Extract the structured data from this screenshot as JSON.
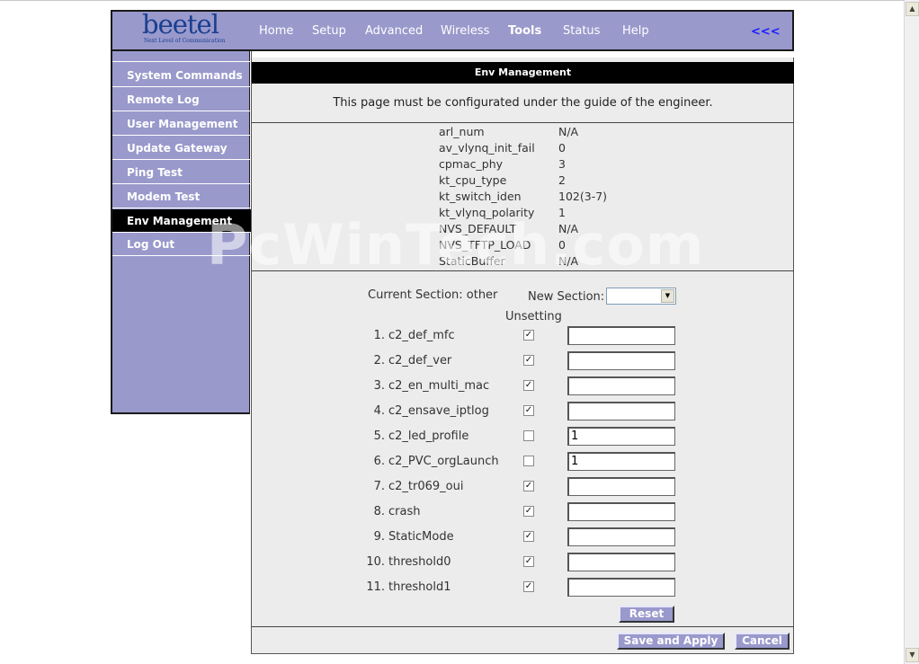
{
  "header": {
    "logo_text": "beetel",
    "logo_tagline": "Next Level of Communication",
    "nav": [
      "Home",
      "Setup",
      "Advanced",
      "Wireless",
      "Tools",
      "Status",
      "Help"
    ],
    "active_nav": "Tools",
    "collapse_label": "<<<"
  },
  "sidebar": {
    "items": [
      {
        "label": "System Commands"
      },
      {
        "label": "Remote Log"
      },
      {
        "label": "User Management"
      },
      {
        "label": "Update Gateway"
      },
      {
        "label": "Ping Test"
      },
      {
        "label": "Modem Test"
      },
      {
        "label": "Env Management"
      },
      {
        "label": "Log Out"
      }
    ],
    "active": "Env Management"
  },
  "main": {
    "title": "Env Management",
    "notice": "This page must be configurated under the guide of the engineer.",
    "env": [
      {
        "k": "arl_num",
        "v": "N/A"
      },
      {
        "k": "av_vlynq_init_fail",
        "v": "0"
      },
      {
        "k": "cpmac_phy",
        "v": "3"
      },
      {
        "k": "kt_cpu_type",
        "v": "2"
      },
      {
        "k": "kt_switch_iden",
        "v": "102(3-7)"
      },
      {
        "k": "kt_vlynq_polarity",
        "v": "1"
      },
      {
        "k": "NVS_DEFAULT",
        "v": "N/A"
      },
      {
        "k": "NVS_TFTP_LOAD",
        "v": "0"
      },
      {
        "k": "StaticBuffer",
        "v": "N/A"
      }
    ],
    "current_section": "Current Section: other",
    "new_section_label": "New Section:",
    "new_section_value": "",
    "unsetting_label": "Unsetting",
    "params": [
      {
        "num": "1.",
        "name": "c2_def_mfc",
        "unset": true,
        "value": ""
      },
      {
        "num": "2.",
        "name": "c2_def_ver",
        "unset": true,
        "value": ""
      },
      {
        "num": "3.",
        "name": "c2_en_multi_mac",
        "unset": true,
        "value": ""
      },
      {
        "num": "4.",
        "name": "c2_ensave_iptlog",
        "unset": true,
        "value": ""
      },
      {
        "num": "5.",
        "name": "c2_led_profile",
        "unset": false,
        "value": "1"
      },
      {
        "num": "6.",
        "name": "c2_PVC_orgLaunch",
        "unset": false,
        "value": "1"
      },
      {
        "num": "7.",
        "name": "c2_tr069_oui",
        "unset": true,
        "value": ""
      },
      {
        "num": "8.",
        "name": "crash",
        "unset": true,
        "value": ""
      },
      {
        "num": "9.",
        "name": "StaticMode",
        "unset": true,
        "value": ""
      },
      {
        "num": "10.",
        "name": "threshold0",
        "unset": true,
        "value": ""
      },
      {
        "num": "11.",
        "name": "threshold1",
        "unset": true,
        "value": ""
      }
    ],
    "reset_label": "Reset",
    "save_label": "Save and Apply",
    "cancel_label": "Cancel"
  },
  "watermark": "PcWinTech.com",
  "icons": {
    "dropdown": "chevron-down-icon",
    "checkbox_checked": "checkmark-icon"
  },
  "colors": {
    "accent": "#9999cc",
    "active_bg": "#000000",
    "link": "#1d1dff"
  }
}
